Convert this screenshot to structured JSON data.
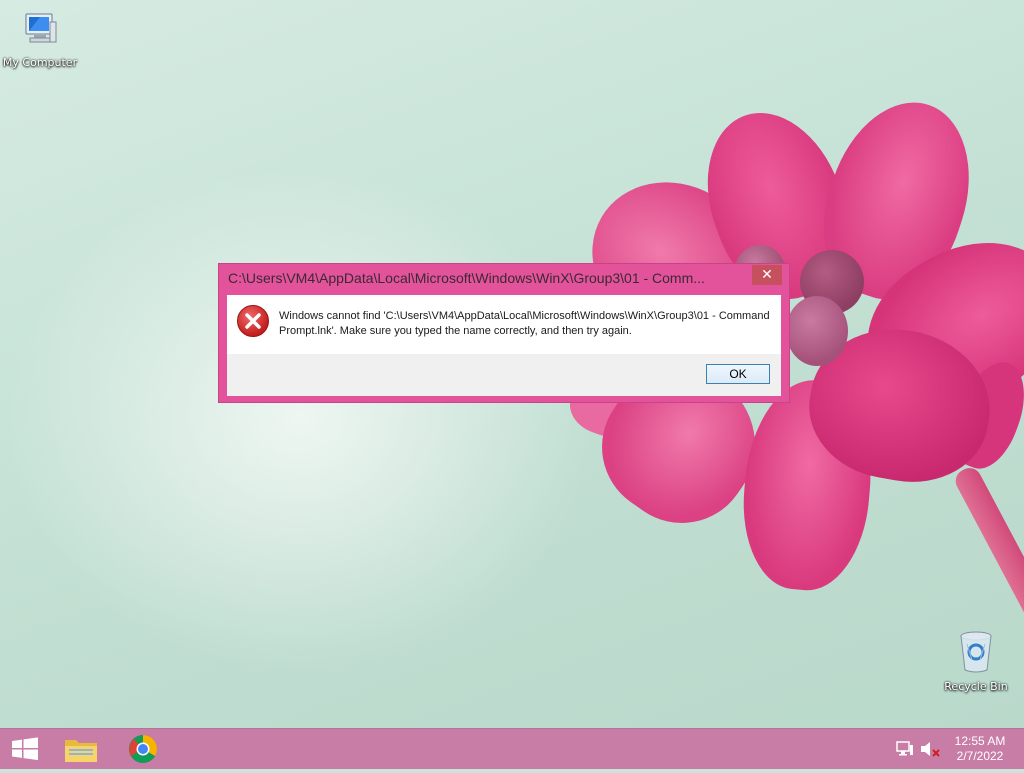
{
  "desktop": {
    "icons": [
      {
        "label": "My Computer",
        "icon": "computer-icon"
      },
      {
        "label": "Recycle Bin",
        "icon": "recycle-bin-icon"
      }
    ]
  },
  "dialog": {
    "title": "C:\\Users\\VM4\\AppData\\Local\\Microsoft\\Windows\\WinX\\Group3\\01 - Comm...",
    "close_label": "✕",
    "icon": "error-icon",
    "message": "Windows cannot find 'C:\\Users\\VM4\\AppData\\Local\\Microsoft\\Windows\\WinX\\Group3\\01 - Command Prompt.lnk'. Make sure you typed the name correctly, and then try again.",
    "ok_label": "OK"
  },
  "taskbar": {
    "pinned": [
      {
        "name": "start",
        "icon": "windows-logo-icon"
      },
      {
        "name": "file-explorer",
        "icon": "folder-icon"
      },
      {
        "name": "chrome",
        "icon": "chrome-icon"
      }
    ],
    "tray": {
      "time": "12:55 AM",
      "date": "2/7/2022"
    }
  },
  "colors": {
    "dialog_frame": "#e3539b",
    "taskbar": "#c77da6",
    "close_button": "#c7505f"
  }
}
